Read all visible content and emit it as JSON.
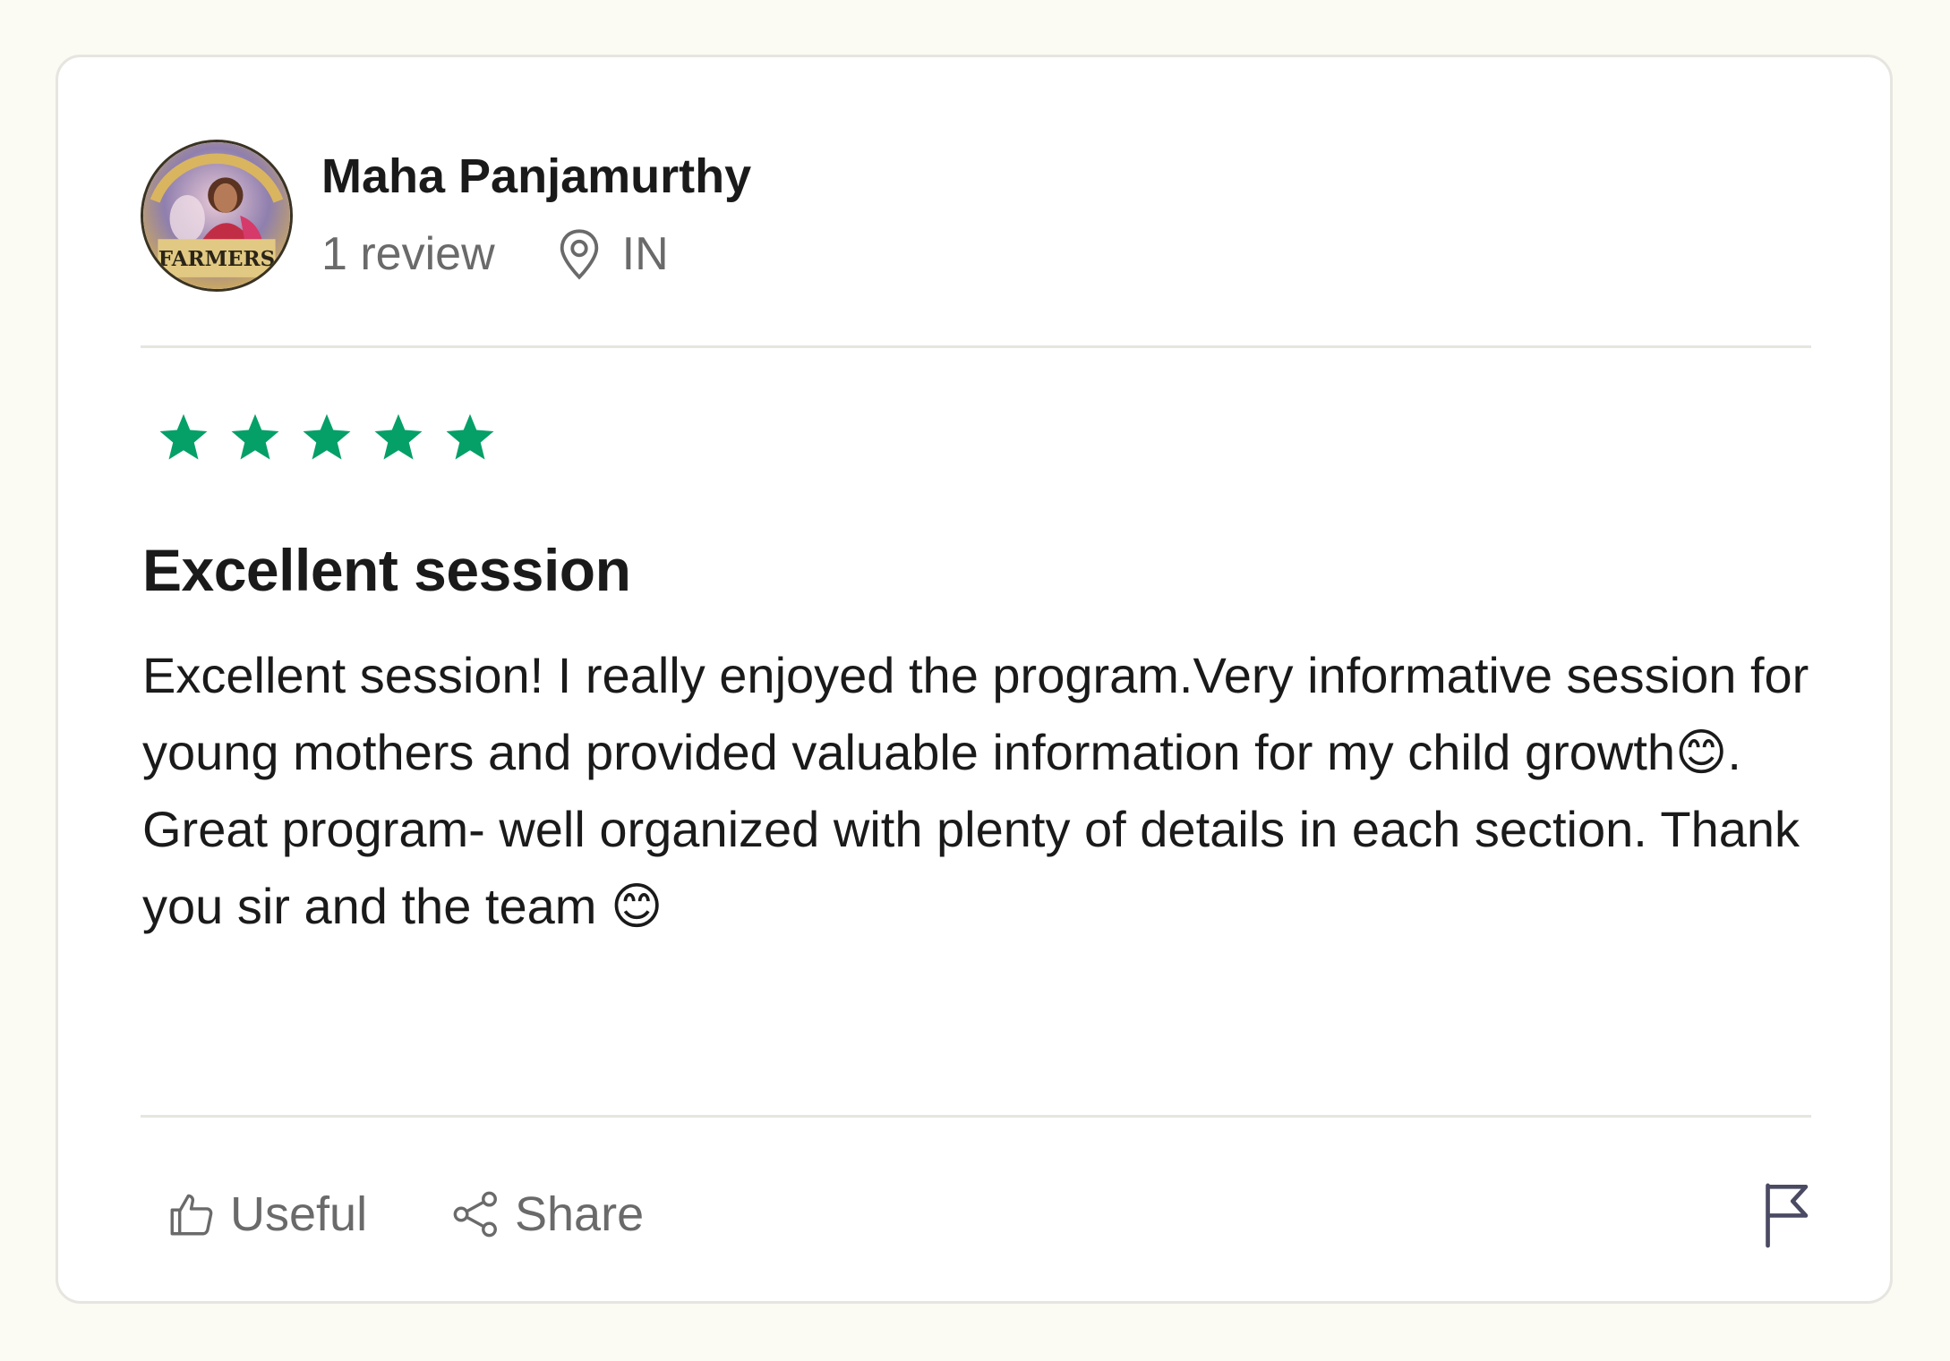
{
  "reviewer": {
    "name": "Maha Panjamurthy",
    "review_count": "1 review",
    "country": "IN",
    "avatar": {
      "icon": "reviewer-avatar",
      "badge_text": "FARMERS"
    }
  },
  "review": {
    "rating": 5,
    "max_rating": 5,
    "title": "Excellent session",
    "body": "Excellent session! I really enjoyed the program.Very informative session for young mothers and provided valuable information for my child growth😊. Great program- well organized with plenty of details in each section. Thank you sir and the team 😊"
  },
  "actions": {
    "useful_label": "Useful",
    "share_label": "Share",
    "report_icon": "flag-icon"
  },
  "colors": {
    "page_bg": "#fbfaf3",
    "star": "#04a068",
    "text": "#1a1a1a",
    "muted": "#6a6a6a",
    "border": "#e6e5df"
  }
}
